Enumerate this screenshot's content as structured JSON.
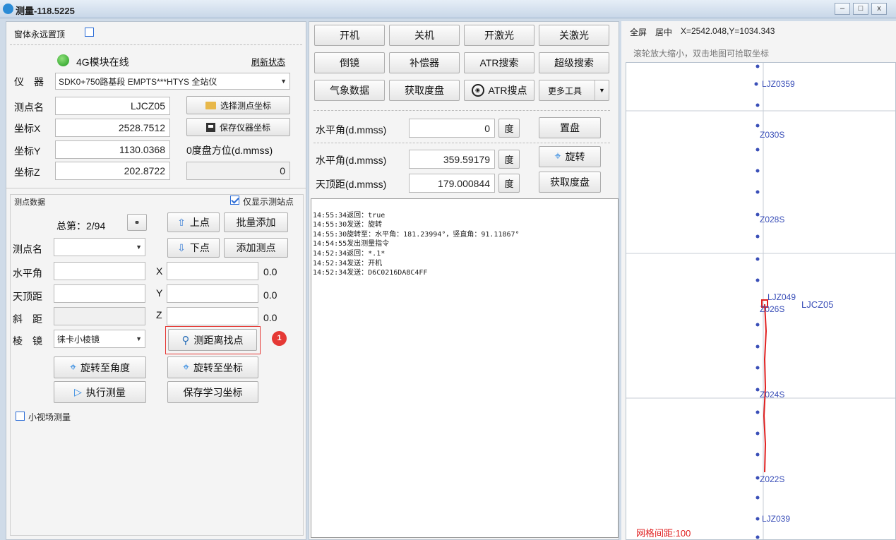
{
  "window": {
    "title": "测量-118.5225",
    "min": "–",
    "max": "□",
    "close": "x"
  },
  "left": {
    "topmost_label": "窗体永远置顶",
    "module_status": "4G模块在线",
    "refresh_link": "刷新状态",
    "instrument_label": "仪　器",
    "instrument_value": "SDK0+750路基段 EMPTS***HTYS 全站仪",
    "point_name_label": "测点名",
    "point_name_value": "LJCZ05",
    "select_point_btn": "选择测点坐标",
    "x_label": "坐标X",
    "x_value": "2528.7512",
    "save_coord_btn": "保存仪器坐标",
    "y_label": "坐标Y",
    "y_value": "1130.0368",
    "zero_azimuth_label": "0度盘方位(d.mmss)",
    "z_label": "坐标Z",
    "z_value": "202.8722",
    "azimuth_value": "0",
    "section_title": "测点数据",
    "only_station_label": "仅显示测站点",
    "total_label": "总第：2/94",
    "prev_btn": "上点",
    "batch_add_btn": "批量添加",
    "row_point_label": "测点名",
    "next_btn": "下点",
    "add_point_btn": "添加测点",
    "h_angle_label": "水平角",
    "zenith_label": "天顶距",
    "slope_label": "斜　距",
    "prism_label": "棱　镜",
    "prism_value": "徕卡小棱镜",
    "px_label": "X",
    "py_label": "Y",
    "pz_label": "Z",
    "px_val": "0.0",
    "py_val": "0.0",
    "pz_val": "0.0",
    "find_btn": "测距离找点",
    "badge": "1",
    "rotate_angle_btn": "旋转至角度",
    "rotate_coord_btn": "旋转至坐标",
    "measure_btn": "执行测量",
    "save_learn_btn": "保存学习坐标",
    "small_fov_label": "小视场测量"
  },
  "mid": {
    "buttons_row1": [
      "开机",
      "关机",
      "开激光",
      "关激光"
    ],
    "buttons_row2": [
      "倒镜",
      "补偿器",
      "ATR搜索",
      "超级搜索"
    ],
    "weather_btn": "气象数据",
    "get_disk_btn": "获取度盘",
    "atr_point_btn": "ATR搜点",
    "more_tools_btn": "更多工具",
    "h_angle_label": "水平角(d.mmss)",
    "h_angle_value": "0",
    "degree_unit": "度",
    "set_disk_btn": "置盘",
    "h_angle2_label": "水平角(d.mmss)",
    "h_angle2_value": "359.59179",
    "rotate_btn": "旋转",
    "zenith_label": "天顶距(d.mmss)",
    "zenith_value": "179.000844",
    "get_disk2_btn": "获取度盘",
    "log": [
      "14:55:34返回：true",
      "14:55:30发送：旋转",
      "14:55:30旋转至：水平角：181.23994°，竖直角：91.11867°",
      "14:54:55发出测量指令",
      "14:52:34返回：*.1*",
      "14:52:34发送：开机",
      "14:52:34发送：D6C0216DA8C4FF"
    ]
  },
  "map": {
    "fullscreen": "全屏",
    "center": "居中",
    "coords": "X=2542.048,Y=1034.343",
    "hint": "滚轮放大缩小，双击地图可拾取坐标",
    "grid_label": "网格间距:100",
    "labels": [
      "LJZ0359",
      "Z030S",
      "Z028S",
      "LJZ049",
      "Z026S",
      "LJCZ05",
      "Z024S",
      "Z022S",
      "LJZ039"
    ]
  }
}
